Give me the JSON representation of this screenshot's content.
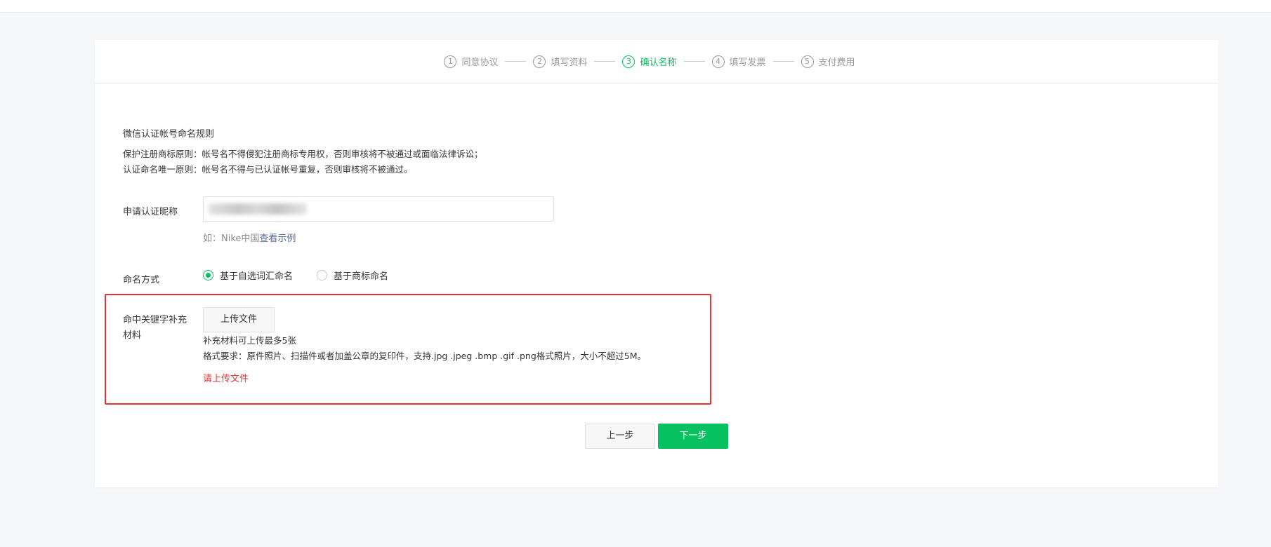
{
  "steps": [
    {
      "num": "1",
      "label": "同意协议"
    },
    {
      "num": "2",
      "label": "填写资料"
    },
    {
      "num": "3",
      "label": "确认名称"
    },
    {
      "num": "4",
      "label": "填写发票"
    },
    {
      "num": "5",
      "label": "支付费用"
    }
  ],
  "active_step": 3,
  "rules": {
    "title": "微信认证帐号命名规则",
    "line1": "保护注册商标原则：帐号名不得侵犯注册商标专用权，否则审核将不被通过或面临法律诉讼；",
    "line2": "认证命名唯一原则：帐号名不得与已认证帐号重复，否则审核将不被通过。"
  },
  "nickname": {
    "label": "申请认证昵称",
    "value": "",
    "hint_prefix": "如：Nike中国",
    "hint_link": "查看示例"
  },
  "naming": {
    "label": "命名方式",
    "options": [
      {
        "label": "基于自选词汇命名",
        "checked": true
      },
      {
        "label": "基于商标命名",
        "checked": false
      }
    ]
  },
  "keyword_material": {
    "label": "命中关键字补充材料",
    "upload_label": "上传文件",
    "note1": "补充材料可上传最多5张",
    "note2": "格式要求：原件照片、扫描件或者加盖公章的复印件，支持.jpg .jpeg .bmp .gif .png格式照片，大小不超过5M。",
    "error": "请上传文件"
  },
  "buttons": {
    "prev": "上一步",
    "next": "下一步"
  },
  "colors": {
    "accent": "#07c160",
    "error": "#e53333",
    "link": "#576b95"
  }
}
